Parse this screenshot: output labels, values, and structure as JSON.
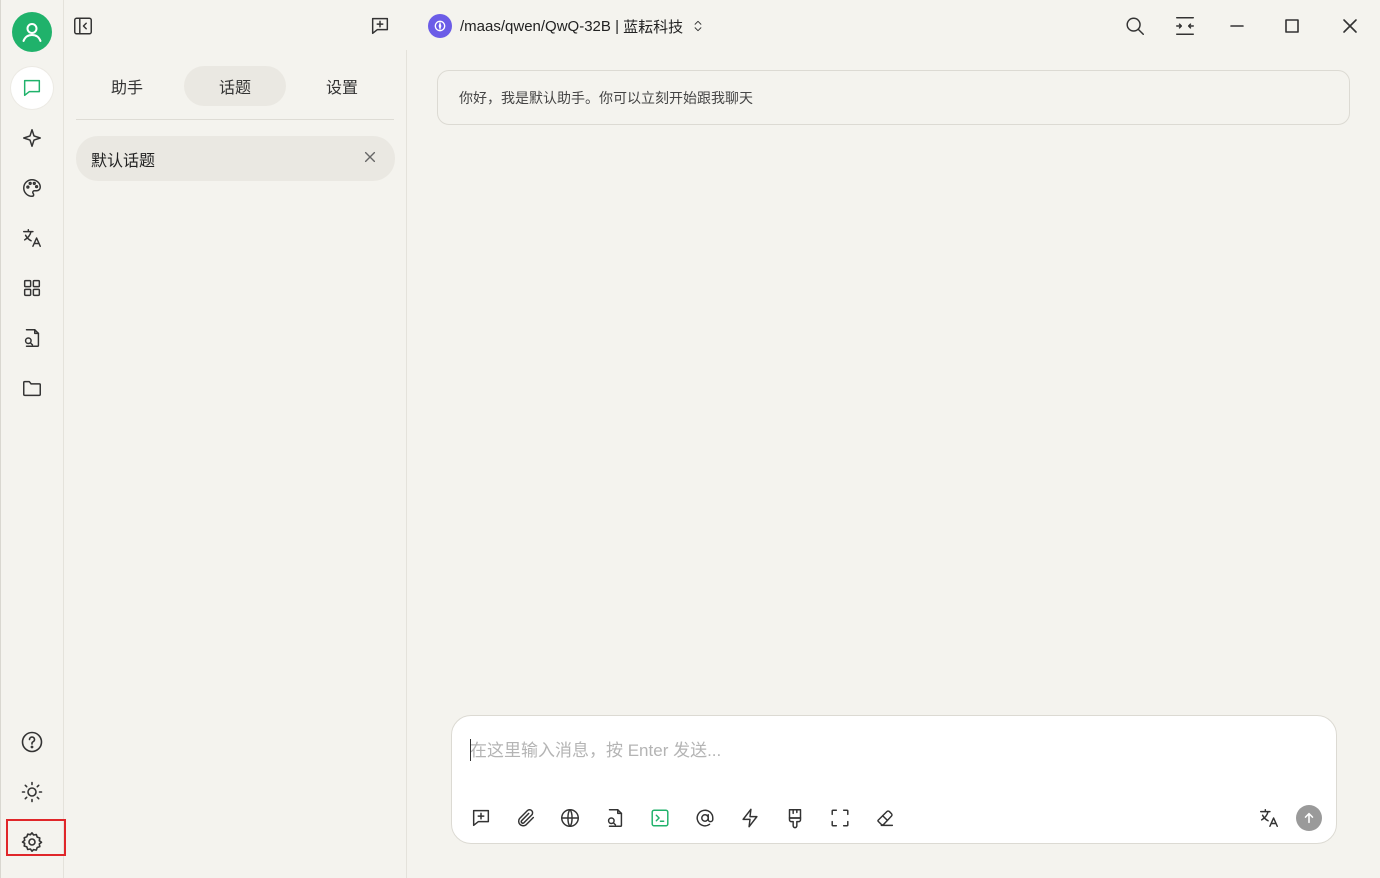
{
  "titlebar": {
    "model_path": "/maas/qwen/QwQ-32B",
    "model_provider": "蓝耘科技",
    "model_separator": " | "
  },
  "sidebar_tabs": [
    {
      "label": "助手",
      "active": false
    },
    {
      "label": "话题",
      "active": true
    },
    {
      "label": "设置",
      "active": false
    }
  ],
  "topics": [
    {
      "label": "默认话题"
    }
  ],
  "chat": {
    "greeting": "你好，我是默认助手。你可以立刻开始跟我聊天"
  },
  "input": {
    "placeholder": "在这里输入消息，按 Enter 发送..."
  },
  "rail_icons": [
    "chat-icon",
    "sparkle-icon",
    "palette-icon",
    "translate-icon",
    "apps-grid-icon",
    "file-search-icon",
    "folder-icon",
    "help-icon",
    "sun-icon",
    "gear-icon"
  ],
  "toolbar_icons": [
    "new-topic-icon",
    "paperclip-icon",
    "globe-icon",
    "file-search-icon",
    "terminal-icon",
    "at-icon",
    "lightning-icon",
    "brush-icon",
    "expand-icon",
    "eraser-icon",
    "translate-icon",
    "send-arrow-icon"
  ],
  "colors": {
    "accent": "#20b26b",
    "background": "#f4f3ee",
    "highlight_box": "#e0262a",
    "model_logo": "#6b5ce7"
  }
}
